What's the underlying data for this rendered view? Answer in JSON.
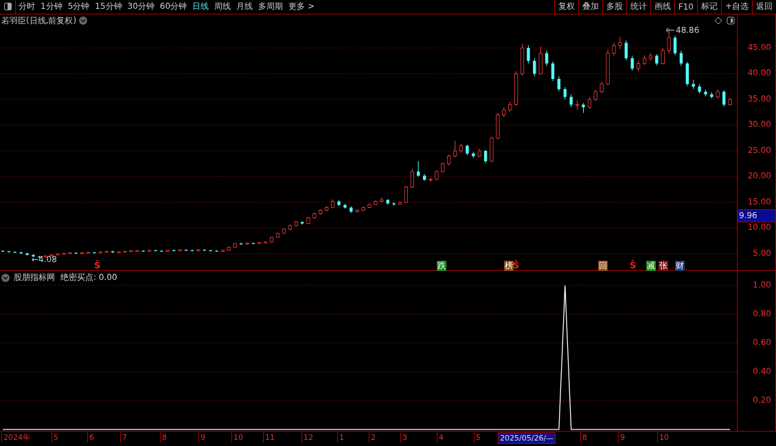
{
  "toolbar": {
    "periods": [
      {
        "label": "分时",
        "selected": false
      },
      {
        "label": "1分钟",
        "selected": false
      },
      {
        "label": "5分钟",
        "selected": false
      },
      {
        "label": "15分钟",
        "selected": false
      },
      {
        "label": "30分钟",
        "selected": false
      },
      {
        "label": "60分钟",
        "selected": false
      },
      {
        "label": "日线",
        "selected": true
      },
      {
        "label": "周线",
        "selected": false
      },
      {
        "label": "月线",
        "selected": false
      },
      {
        "label": "多周期",
        "selected": false
      },
      {
        "label": "更多 >",
        "selected": false
      }
    ],
    "actions": [
      "复权",
      "叠加",
      "多股",
      "统计",
      "画线",
      "F10",
      "标记",
      "+自选",
      "返回"
    ]
  },
  "price_chart": {
    "title": "若羽臣(日线,前复权)",
    "high_label": "48.86",
    "low_label": "4.08",
    "low_arrow": "←",
    "current_price": "9.96",
    "chart_data": {
      "type": "candlestick",
      "ohlc": [
        [
          5.6,
          5.7,
          5.4,
          5.5
        ],
        [
          5.5,
          5.6,
          5.3,
          5.4
        ],
        [
          5.4,
          5.5,
          5.2,
          5.3
        ],
        [
          5.3,
          5.4,
          5.0,
          5.1
        ],
        [
          5.1,
          5.2,
          4.7,
          4.8
        ],
        [
          4.8,
          4.9,
          4.4,
          4.5
        ],
        [
          4.5,
          4.6,
          4.08,
          4.4
        ],
        [
          4.4,
          4.7,
          4.3,
          4.6
        ],
        [
          4.6,
          4.9,
          4.5,
          4.8
        ],
        [
          4.8,
          5.1,
          4.7,
          5.0
        ],
        [
          5.0,
          5.2,
          4.9,
          5.1
        ],
        [
          5.1,
          5.3,
          5.0,
          5.2
        ],
        [
          5.2,
          5.3,
          5.0,
          5.1
        ],
        [
          5.1,
          5.3,
          5.0,
          5.2
        ],
        [
          5.2,
          5.4,
          5.1,
          5.3
        ],
        [
          5.3,
          5.4,
          5.1,
          5.2
        ],
        [
          5.2,
          5.5,
          5.1,
          5.4
        ],
        [
          5.4,
          5.6,
          5.3,
          5.5
        ],
        [
          5.5,
          5.6,
          5.2,
          5.3
        ],
        [
          5.3,
          5.5,
          5.2,
          5.4
        ],
        [
          5.4,
          5.6,
          5.3,
          5.5
        ],
        [
          5.5,
          5.7,
          5.4,
          5.6
        ],
        [
          5.5,
          5.7,
          5.45,
          5.65
        ],
        [
          5.6,
          5.7,
          5.4,
          5.5
        ],
        [
          5.5,
          5.8,
          5.4,
          5.7
        ],
        [
          5.7,
          5.8,
          5.5,
          5.6
        ],
        [
          5.6,
          5.7,
          5.4,
          5.5
        ],
        [
          5.5,
          5.8,
          5.4,
          5.7
        ],
        [
          5.7,
          5.8,
          5.5,
          5.6
        ],
        [
          5.6,
          5.9,
          5.5,
          5.8
        ],
        [
          5.8,
          5.9,
          5.6,
          5.7
        ],
        [
          5.7,
          5.8,
          5.5,
          5.6
        ],
        [
          5.6,
          5.9,
          5.5,
          5.8
        ],
        [
          5.8,
          5.9,
          5.6,
          5.7
        ],
        [
          5.7,
          5.8,
          5.5,
          5.6
        ],
        [
          5.6,
          5.7,
          5.4,
          5.5
        ],
        [
          5.5,
          5.8,
          5.4,
          5.7
        ],
        [
          5.7,
          6.4,
          5.6,
          6.3
        ],
        [
          6.3,
          7.1,
          6.2,
          7.0
        ],
        [
          7.0,
          7.2,
          6.8,
          6.9
        ],
        [
          6.9,
          7.2,
          6.8,
          7.1
        ],
        [
          7.1,
          7.2,
          6.9,
          7.0
        ],
        [
          7.0,
          7.3,
          6.9,
          7.2
        ],
        [
          7.2,
          7.4,
          7.1,
          7.3
        ],
        [
          7.3,
          8.3,
          7.2,
          8.2
        ],
        [
          8.2,
          9.1,
          8.1,
          9.0
        ],
        [
          9.0,
          9.9,
          8.9,
          9.8
        ],
        [
          9.8,
          10.7,
          9.6,
          10.5
        ],
        [
          10.5,
          11.4,
          10.3,
          11.2
        ],
        [
          11.2,
          11.3,
          10.7,
          10.9
        ],
        [
          10.9,
          12.2,
          10.8,
          12.0
        ],
        [
          12.0,
          13.0,
          11.8,
          12.8
        ],
        [
          12.8,
          13.7,
          12.6,
          13.5
        ],
        [
          13.5,
          14.3,
          13.3,
          14.0
        ],
        [
          14.0,
          15.6,
          13.9,
          15.2
        ],
        [
          15.2,
          15.4,
          14.3,
          14.5
        ],
        [
          14.5,
          14.7,
          13.8,
          14.0
        ],
        [
          14.0,
          14.2,
          13.0,
          13.2
        ],
        [
          13.2,
          13.7,
          13.0,
          13.5
        ],
        [
          13.5,
          14.2,
          13.3,
          14.0
        ],
        [
          14.0,
          14.8,
          13.9,
          14.6
        ],
        [
          14.6,
          15.4,
          14.5,
          15.2
        ],
        [
          15.2,
          16.0,
          15.0,
          15.5
        ],
        [
          15.5,
          15.6,
          14.6,
          14.8
        ],
        [
          14.8,
          15.0,
          14.4,
          14.6
        ],
        [
          14.6,
          15.2,
          14.5,
          15.0
        ],
        [
          15.0,
          18.2,
          14.9,
          18.0
        ],
        [
          18.0,
          21.5,
          17.8,
          21.0
        ],
        [
          21.0,
          23.0,
          20.0,
          20.2
        ],
        [
          20.2,
          20.5,
          19.2,
          19.4
        ],
        [
          19.4,
          19.8,
          19.0,
          19.5
        ],
        [
          19.5,
          21.3,
          19.3,
          21.0
        ],
        [
          21.0,
          22.8,
          20.8,
          22.5
        ],
        [
          22.5,
          24.3,
          22.2,
          24.0
        ],
        [
          24.0,
          27.0,
          23.8,
          25.0
        ],
        [
          25.0,
          26.4,
          24.7,
          26.0
        ],
        [
          26.0,
          26.2,
          24.2,
          24.5
        ],
        [
          24.5,
          24.8,
          23.7,
          24.0
        ],
        [
          24.0,
          25.4,
          23.8,
          25.0
        ],
        [
          25.0,
          25.2,
          22.6,
          23.0
        ],
        [
          23.0,
          27.8,
          22.8,
          27.5
        ],
        [
          27.5,
          32.4,
          27.3,
          32.0
        ],
        [
          32.0,
          33.5,
          31.5,
          33.0
        ],
        [
          33.0,
          34.6,
          32.6,
          34.0
        ],
        [
          34.0,
          40.5,
          33.8,
          40.0
        ],
        [
          40.0,
          45.8,
          39.6,
          45.0
        ],
        [
          45.0,
          45.5,
          42.0,
          42.5
        ],
        [
          42.5,
          43.0,
          39.5,
          40.0
        ],
        [
          40.0,
          45.3,
          39.8,
          44.0
        ],
        [
          44.0,
          44.5,
          41.5,
          42.0
        ],
        [
          42.0,
          42.4,
          38.6,
          39.0
        ],
        [
          39.0,
          39.5,
          36.6,
          37.0
        ],
        [
          37.0,
          37.4,
          35.0,
          35.5
        ],
        [
          35.5,
          36.0,
          33.5,
          34.0
        ],
        [
          34.0,
          34.8,
          33.0,
          34.0
        ],
        [
          34.0,
          34.3,
          32.4,
          33.5
        ],
        [
          33.5,
          35.4,
          33.2,
          35.0
        ],
        [
          35.0,
          36.9,
          34.7,
          36.5
        ],
        [
          36.5,
          38.5,
          36.2,
          38.0
        ],
        [
          38.0,
          44.7,
          37.8,
          44.0
        ],
        [
          44.0,
          46.0,
          43.5,
          45.5
        ],
        [
          45.5,
          47.2,
          44.8,
          46.0
        ],
        [
          46.0,
          46.5,
          42.6,
          43.0
        ],
        [
          43.0,
          43.5,
          40.6,
          41.0
        ],
        [
          41.0,
          42.5,
          40.5,
          42.0
        ],
        [
          42.0,
          43.6,
          41.7,
          43.0
        ],
        [
          43.0,
          44.0,
          42.5,
          43.5
        ],
        [
          43.5,
          43.8,
          41.6,
          42.0
        ],
        [
          42.0,
          45.0,
          41.8,
          44.5
        ],
        [
          44.5,
          48.86,
          44.0,
          47.0
        ],
        [
          47.0,
          47.4,
          43.6,
          44.0
        ],
        [
          44.0,
          44.5,
          41.5,
          42.0
        ],
        [
          42.0,
          42.3,
          37.6,
          38.0
        ],
        [
          38.0,
          38.8,
          37.0,
          37.5
        ],
        [
          37.5,
          38.0,
          36.2,
          36.5
        ],
        [
          36.5,
          36.9,
          35.6,
          36.0
        ],
        [
          36.0,
          36.4,
          35.2,
          35.5
        ],
        [
          35.5,
          37.0,
          35.2,
          36.5
        ],
        [
          36.5,
          36.8,
          33.6,
          34.0
        ],
        [
          34.0,
          35.3,
          33.8,
          35.0
        ]
      ],
      "ylim": [
        1.67,
        51.53
      ],
      "grid": true,
      "yticks": [
        {
          "value": 45,
          "label": "45.00"
        },
        {
          "value": 40,
          "label": "40.00"
        },
        {
          "value": 35,
          "label": "35.00"
        },
        {
          "value": 30,
          "label": "30.00"
        },
        {
          "value": 25,
          "label": "25.00"
        },
        {
          "value": 20,
          "label": "20.00"
        },
        {
          "value": 15,
          "label": "15.00"
        },
        {
          "value": 10,
          "label": "10.00"
        },
        {
          "value": 5,
          "label": "5.00"
        }
      ]
    },
    "markers": [
      {
        "kind": "signal",
        "text": "Ŝ"
      },
      {
        "kind": "tag",
        "text": "跌",
        "color": "#1e8a1e"
      },
      {
        "kind": "tag",
        "text": "榜",
        "color": "#8a4a10"
      },
      {
        "kind": "signal",
        "text": "Ŝ"
      },
      {
        "kind": "tag",
        "text": "回",
        "color": "#8a4a10"
      },
      {
        "kind": "signal",
        "text": "Ŝ"
      },
      {
        "kind": "tag",
        "text": "减",
        "color": "#1e8a1e"
      },
      {
        "kind": "tag",
        "text": "张",
        "color": "#7a1010"
      },
      {
        "kind": "tag",
        "text": "财",
        "color": "#1a3a7a"
      }
    ]
  },
  "indicator": {
    "name": "股朋指标网",
    "reading": "绝密买点: 0.00",
    "chart_data": {
      "type": "line",
      "ylim": [
        -0.01,
        1.1
      ],
      "grid": true,
      "yticks": [
        {
          "value": 1,
          "label": "1.00"
        },
        {
          "value": 0.8,
          "label": "0.80"
        },
        {
          "value": 0.6,
          "label": "0.60"
        },
        {
          "value": 0.4,
          "label": "0.40"
        },
        {
          "value": 0.2,
          "label": "0.20"
        }
      ],
      "values": [
        0,
        0,
        0,
        0,
        0,
        0,
        0,
        0,
        0,
        0,
        0,
        0,
        0,
        0,
        0,
        0,
        0,
        0,
        0,
        0,
        0,
        0,
        0,
        0,
        0,
        0,
        0,
        0,
        0,
        0,
        0,
        0,
        0,
        0,
        0,
        0,
        0,
        0,
        0,
        0,
        0,
        0,
        0,
        0,
        0,
        0,
        0,
        0,
        0,
        0,
        0,
        0,
        0,
        0,
        0,
        0,
        0,
        0,
        0,
        0,
        0,
        0,
        0,
        0,
        0,
        0,
        0,
        0,
        0,
        0,
        0,
        0,
        0,
        0,
        0,
        0,
        0,
        0,
        0,
        0,
        0,
        0,
        0,
        0,
        0,
        0,
        0,
        0,
        0,
        0,
        0,
        0,
        1,
        0,
        0,
        0,
        0,
        0,
        0,
        0,
        0,
        0,
        0,
        0,
        0,
        0,
        0,
        0,
        0,
        0,
        0,
        0,
        0,
        0,
        0,
        0,
        0,
        0,
        0,
        0
      ]
    }
  },
  "date_axis": [
    {
      "label": "2024年",
      "selected": false
    },
    {
      "label": "5",
      "selected": false
    },
    {
      "label": "6",
      "selected": false
    },
    {
      "label": "7",
      "selected": false
    },
    {
      "label": "8",
      "selected": false
    },
    {
      "label": "9",
      "selected": false
    },
    {
      "label": "10",
      "selected": false
    },
    {
      "label": "11",
      "selected": false
    },
    {
      "label": "12",
      "selected": false
    },
    {
      "label": "1",
      "selected": false
    },
    {
      "label": "2",
      "selected": false
    },
    {
      "label": "3",
      "selected": false
    },
    {
      "label": "4",
      "selected": false
    },
    {
      "label": "5",
      "selected": false
    },
    {
      "label": "2025/05/26/—",
      "selected": true
    },
    {
      "label": "8",
      "selected": false
    },
    {
      "label": "9",
      "selected": false
    },
    {
      "label": "10",
      "selected": false
    }
  ]
}
